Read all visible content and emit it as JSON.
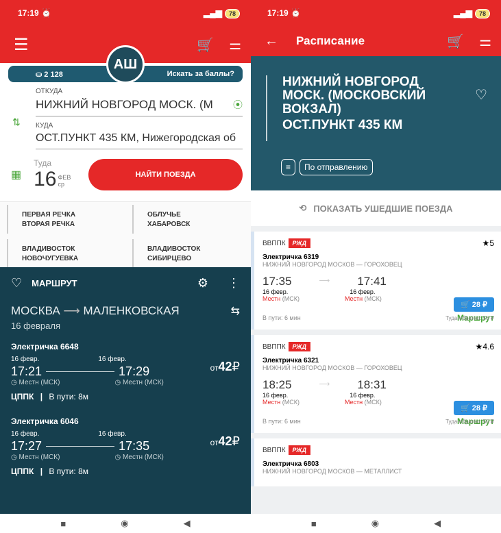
{
  "status": {
    "time": "17:19",
    "alarm_icon": "alarm-clock-icon",
    "signal": "signal-icon",
    "battery": "78"
  },
  "left": {
    "toolbar": {
      "menu_icon": "hamburger-menu-icon",
      "cart_icon": "cart-icon",
      "filter_icon": "sliders-icon"
    },
    "avatar": "АШ",
    "points": {
      "value": "2 128",
      "action": "Искать за баллы?"
    },
    "from": {
      "label": "ОТКУДА",
      "value": "НИЖНИЙ НОВГОРОД МОСК. (М"
    },
    "to": {
      "label": "КУДА",
      "value": "ОСТ.ПУНКТ 435 КМ, Нижегородская об"
    },
    "date": {
      "label": "Туда",
      "day": "16",
      "month": "ФЕВ",
      "weekday": "ср"
    },
    "search_button": "НАЙТИ ПОЕЗДА",
    "recent": [
      {
        "a": "ПЕРВАЯ РЕЧКА",
        "b": "ВТОРАЯ РЕЧКА"
      },
      {
        "a": "ОБЛУЧЬЕ",
        "b": "ХАБАРОВСК"
      },
      {
        "a": "ВЛАДИВОСТОК",
        "b": "НОВОЧУГУЕВКА"
      },
      {
        "a": "ВЛАДИВОСТОК",
        "b": "СИБИРЦЕВО"
      }
    ],
    "route": {
      "title": "МАРШРУТ",
      "from": "МОСКВА",
      "to": "МАЛЕНКОВСКАЯ",
      "date": "16 февраля",
      "trains": [
        {
          "name": "Электричка 6648",
          "dep_date": "16 февр.",
          "dep_time": "17:21",
          "dep_tz": "Местн (МСК)",
          "arr_date": "16 февр.",
          "arr_time": "17:29",
          "arr_tz": "Местн (МСК)",
          "price_prefix": "от",
          "price": "42",
          "currency": "₽",
          "carrier": "ЦППК",
          "sep": "|",
          "duration": "В пути: 8м"
        },
        {
          "name": "Электричка 6046",
          "dep_date": "16 февр.",
          "dep_time": "17:27",
          "dep_tz": "Местн (МСК)",
          "arr_date": "16 февр.",
          "arr_time": "17:35",
          "arr_tz": "Местн (МСК)",
          "price_prefix": "от",
          "price": "42",
          "currency": "₽",
          "carrier": "ЦППК",
          "sep": "|",
          "duration": "В пути: 8м"
        }
      ]
    }
  },
  "right": {
    "title": "Расписание",
    "route_title": "НИЖНИЙ НОВГОРОД МОСК. (МОСКОВСКИЙ ВОКЗАЛ)",
    "route_dest": "ОСТ.ПУНКТ 435 КМ",
    "sort_label": "По отправлению",
    "show_departed": "ПОКАЗАТЬ УШЕДШИЕ ПОЕЗДА",
    "trains": [
      {
        "carrier": "ВВППК",
        "logo": "РЖД",
        "rating": "5",
        "name": "Электричка 6319",
        "route": "НИЖНИЙ НОВГОРОД МОСКОВ — ГОРОХОВЕЦ",
        "dep_time": "17:35",
        "dep_date": "16 февр.",
        "dep_tz_red": "Местн",
        "dep_tz": "(МСК)",
        "arr_time": "17:41",
        "arr_date": "16 февр.",
        "arr_tz_red": "Местн",
        "arr_tz": "(МСК)",
        "price": "28 ₽",
        "roundtrip": "Туда-обратно: 56 ₽",
        "duration": "В пути: 6 мин",
        "route_link": "Маршрут"
      },
      {
        "carrier": "ВВППК",
        "logo": "РЖД",
        "rating": "4.6",
        "name": "Электричка 6321",
        "route": "НИЖНИЙ НОВГОРОД МОСКОВ — ГОРОХОВЕЦ",
        "dep_time": "18:25",
        "dep_date": "16 февр.",
        "dep_tz_red": "Местн",
        "dep_tz": "(МСК)",
        "arr_time": "18:31",
        "arr_date": "16 февр.",
        "arr_tz_red": "Местн",
        "arr_tz": "(МСК)",
        "price": "28 ₽",
        "roundtrip": "Туда-обратно: 56 ₽",
        "duration": "В пути: 6 мин",
        "route_link": "Маршрут"
      },
      {
        "carrier": "ВВППК",
        "logo": "РЖД",
        "name": "Электричка 6803",
        "route": "НИЖНИЙ НОВГОРОД МОСКОВ — МЕТАЛЛИСТ"
      }
    ]
  }
}
